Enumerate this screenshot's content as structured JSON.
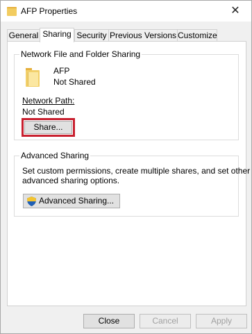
{
  "window": {
    "title": "AFP Properties",
    "close_glyph": "✕"
  },
  "tabs": [
    "General",
    "Sharing",
    "Security",
    "Previous Versions",
    "Customize"
  ],
  "network_sharing": {
    "group_label": "Network File and Folder Sharing",
    "folder_name": "AFP",
    "folder_status": "Not Shared",
    "path_label": "Network Path:",
    "path_value": "Not Shared",
    "share_button": "Share..."
  },
  "advanced_sharing": {
    "group_label": "Advanced Sharing",
    "description_line1": "Set custom permissions, create multiple shares, and set other",
    "description_line2": "advanced sharing options.",
    "button_label": "Advanced Sharing..."
  },
  "footer": {
    "close": "Close",
    "cancel": "Cancel",
    "apply": "Apply"
  },
  "colors": {
    "highlight": "#c8202f",
    "tab_border": "#d0d0d0",
    "window_bg": "#f0f0f0"
  }
}
